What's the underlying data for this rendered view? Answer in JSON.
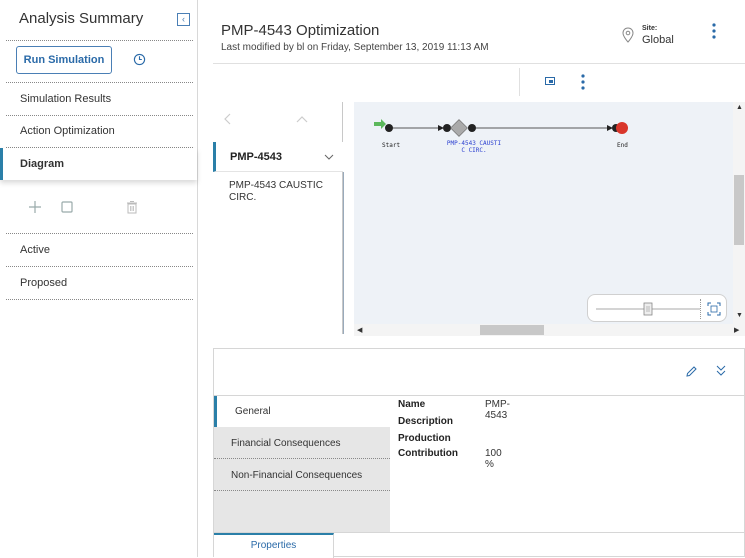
{
  "left_panel": {
    "title": "Analysis Summary",
    "collapse_glyph": "‹",
    "run_button": "Run Simulation",
    "nav_items": [
      "Simulation Results",
      "Action Optimization",
      "Diagram"
    ],
    "sections": [
      "Active",
      "Proposed"
    ]
  },
  "header": {
    "title": "PMP-4543 Optimization",
    "subtitle": "Last modified by bl on Friday, September 13, 2019 11:13 AM",
    "site_label": "Site:",
    "site_value": "Global"
  },
  "tree": {
    "node_label": "PMP-4543",
    "child_label": "PMP-4543 CAUSTIC CIRC."
  },
  "diagram": {
    "start_label": "Start",
    "asset_label_line1": "PMP-4543 CAUSTI",
    "asset_label_line2": "C CIRC.",
    "end_label": "End"
  },
  "properties": {
    "tabs": [
      "General",
      "Financial Consequences",
      "Non-Financial Consequences"
    ],
    "fields": [
      {
        "key": "Name",
        "value": "PMP-4543"
      },
      {
        "key": "Description",
        "value": ""
      },
      {
        "key": "Production",
        "value": ""
      },
      {
        "key": "Contribution",
        "value": "100 %"
      }
    ],
    "bottom_tab": "Properties"
  },
  "colors": {
    "accent": "#2a7fa8",
    "link": "#2a6aa8",
    "start_green": "#5cb85c",
    "end_red": "#d9362b"
  },
  "icons": [
    "collapse-icon",
    "history-icon",
    "add-icon",
    "copy-icon",
    "delete-icon",
    "location-pin-icon",
    "more-vertical-icon",
    "window-icon",
    "edit-icon",
    "double-chevron-down-icon",
    "fit-screen-icon"
  ]
}
